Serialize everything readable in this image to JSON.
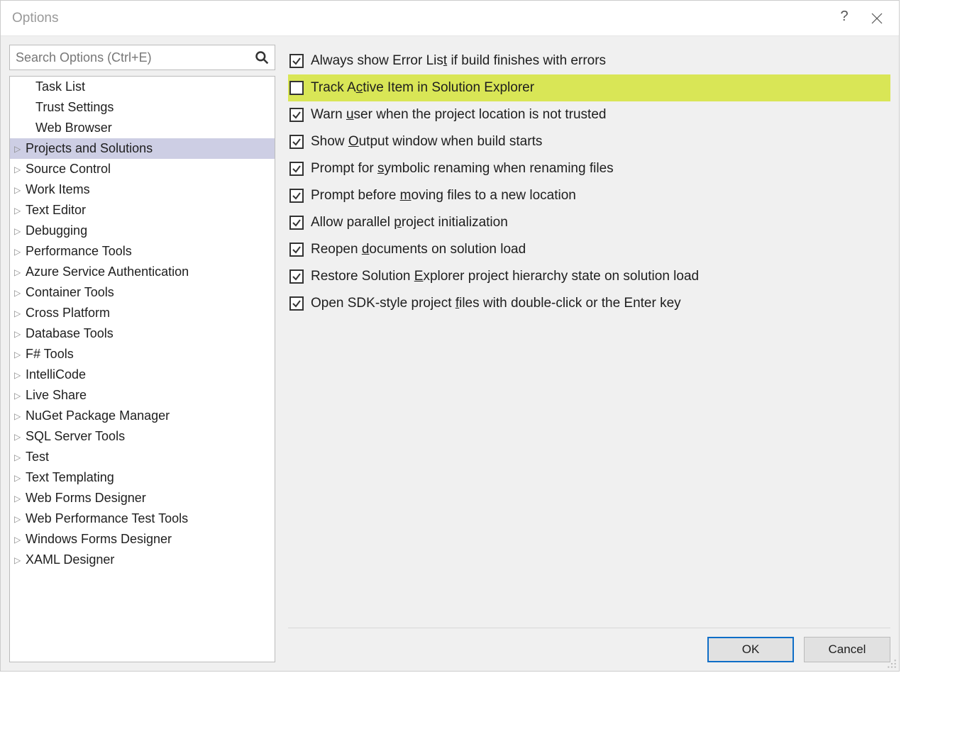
{
  "title": "Options",
  "search": {
    "placeholder": "Search Options (Ctrl+E)"
  },
  "tree": {
    "items": [
      {
        "label": "Task List",
        "child": true,
        "selected": false
      },
      {
        "label": "Trust Settings",
        "child": true,
        "selected": false
      },
      {
        "label": "Web Browser",
        "child": true,
        "selected": false
      },
      {
        "label": "Projects and Solutions",
        "child": false,
        "selected": true
      },
      {
        "label": "Source Control",
        "child": false,
        "selected": false
      },
      {
        "label": "Work Items",
        "child": false,
        "selected": false
      },
      {
        "label": "Text Editor",
        "child": false,
        "selected": false
      },
      {
        "label": "Debugging",
        "child": false,
        "selected": false
      },
      {
        "label": "Performance Tools",
        "child": false,
        "selected": false
      },
      {
        "label": "Azure Service Authentication",
        "child": false,
        "selected": false
      },
      {
        "label": "Container Tools",
        "child": false,
        "selected": false
      },
      {
        "label": "Cross Platform",
        "child": false,
        "selected": false
      },
      {
        "label": "Database Tools",
        "child": false,
        "selected": false
      },
      {
        "label": "F# Tools",
        "child": false,
        "selected": false
      },
      {
        "label": "IntelliCode",
        "child": false,
        "selected": false
      },
      {
        "label": "Live Share",
        "child": false,
        "selected": false
      },
      {
        "label": "NuGet Package Manager",
        "child": false,
        "selected": false
      },
      {
        "label": "SQL Server Tools",
        "child": false,
        "selected": false
      },
      {
        "label": "Test",
        "child": false,
        "selected": false
      },
      {
        "label": "Text Templating",
        "child": false,
        "selected": false
      },
      {
        "label": "Web Forms Designer",
        "child": false,
        "selected": false
      },
      {
        "label": "Web Performance Test Tools",
        "child": false,
        "selected": false
      },
      {
        "label": "Windows Forms Designer",
        "child": false,
        "selected": false
      },
      {
        "label": "XAML Designer",
        "child": false,
        "selected": false
      }
    ]
  },
  "checks": [
    {
      "pre": "Always show Error Lis",
      "key": "t",
      "post": " if build finishes with errors",
      "checked": true,
      "highlight": false
    },
    {
      "pre": "Track A",
      "key": "c",
      "post": "tive Item in Solution Explorer",
      "checked": false,
      "highlight": true
    },
    {
      "pre": "Warn ",
      "key": "u",
      "post": "ser when the project location is not trusted",
      "checked": true,
      "highlight": false
    },
    {
      "pre": "Show ",
      "key": "O",
      "post": "utput window when build starts",
      "checked": true,
      "highlight": false
    },
    {
      "pre": "Prompt for ",
      "key": "s",
      "post": "ymbolic renaming when renaming files",
      "checked": true,
      "highlight": false
    },
    {
      "pre": "Prompt before ",
      "key": "m",
      "post": "oving files to a new location",
      "checked": true,
      "highlight": false
    },
    {
      "pre": "Allow parallel ",
      "key": "p",
      "post": "roject initialization",
      "checked": true,
      "highlight": false
    },
    {
      "pre": "Reopen ",
      "key": "d",
      "post": "ocuments on solution load",
      "checked": true,
      "highlight": false
    },
    {
      "pre": "Restore Solution ",
      "key": "E",
      "post": "xplorer project hierarchy state on solution load",
      "checked": true,
      "highlight": false
    },
    {
      "pre": "Open SDK-style project ",
      "key": "f",
      "post": "iles with double-click or the Enter key",
      "checked": true,
      "highlight": false
    }
  ],
  "buttons": {
    "ok": "OK",
    "cancel": "Cancel"
  }
}
